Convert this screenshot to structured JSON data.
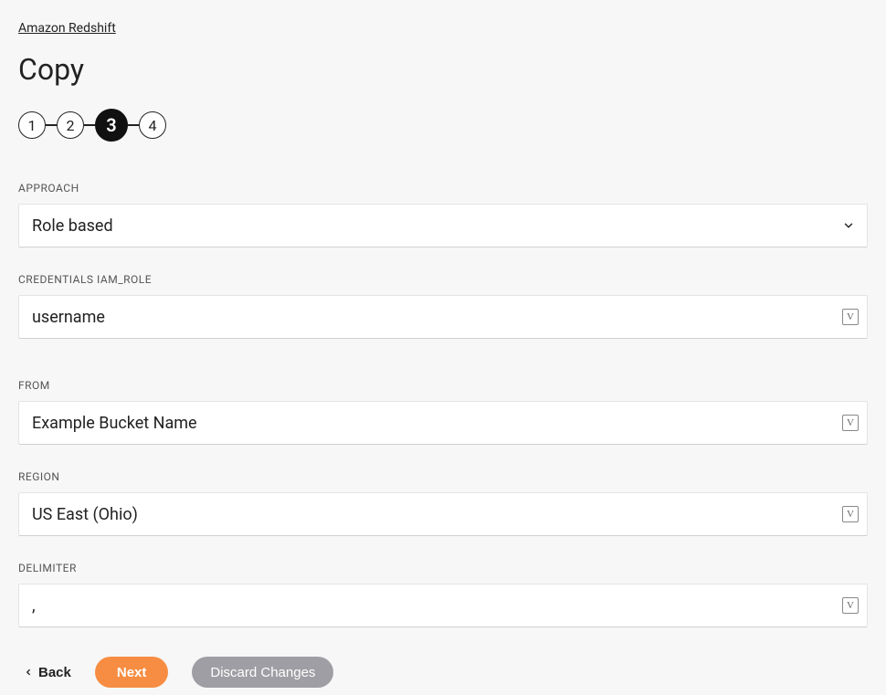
{
  "breadcrumb": "Amazon Redshift",
  "page_title": "Copy",
  "stepper": {
    "steps": [
      "1",
      "2",
      "3",
      "4"
    ],
    "active_index": 2
  },
  "fields": {
    "approach": {
      "label": "APPROACH",
      "value": "Role based"
    },
    "credentials": {
      "label": "CREDENTIALS IAM_ROLE",
      "value": "username"
    },
    "from": {
      "label": "FROM",
      "value": "Example Bucket Name"
    },
    "region": {
      "label": "REGION",
      "value": "US East (Ohio)"
    },
    "delimiter": {
      "label": "DELIMITER",
      "value": ","
    }
  },
  "footer": {
    "back": "Back",
    "next": "Next",
    "discard": "Discard Changes"
  },
  "icons": {
    "variable_glyph": "V"
  }
}
